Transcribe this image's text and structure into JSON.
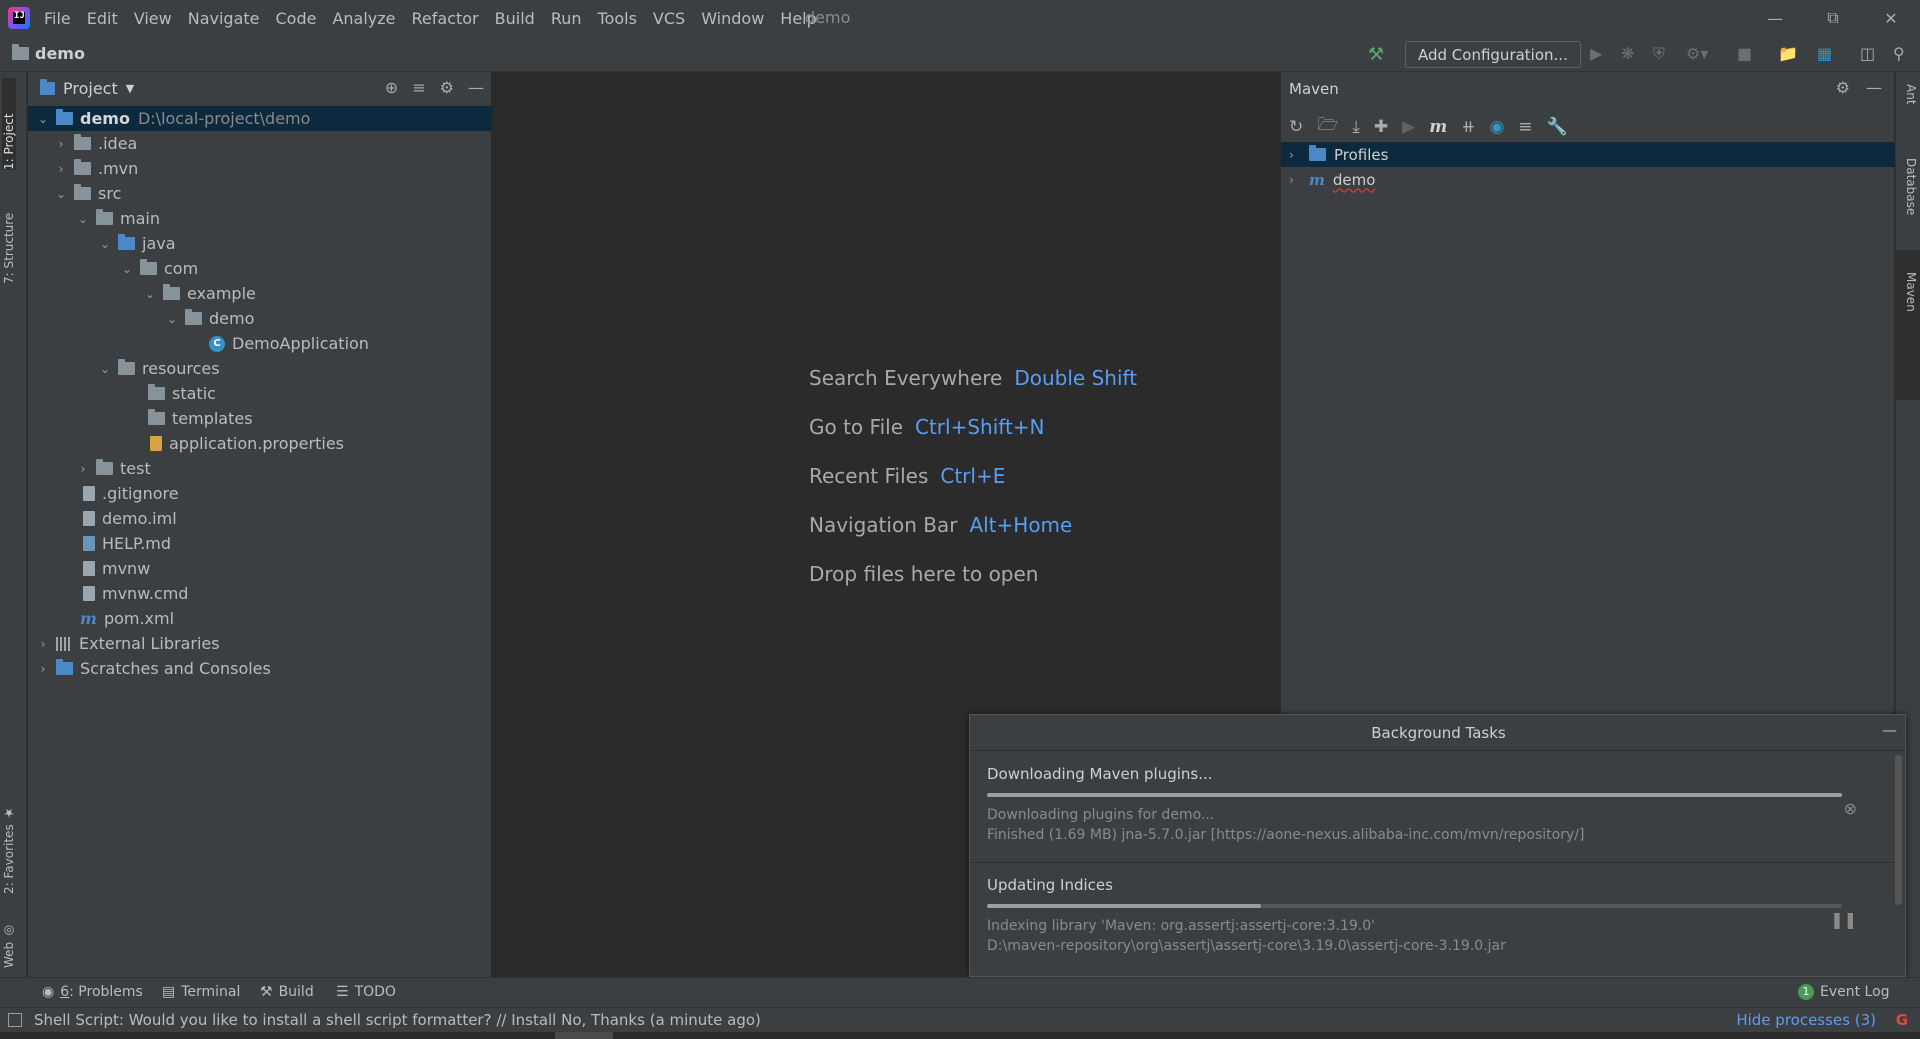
{
  "menu": [
    "File",
    "Edit",
    "View",
    "Navigate",
    "Code",
    "Analyze",
    "Refactor",
    "Build",
    "Run",
    "Tools",
    "VCS",
    "Window",
    "Help"
  ],
  "title_project": "demo",
  "navbar": {
    "breadcrumb": "demo",
    "add_configuration": "Add Configuration..."
  },
  "left_strip": {
    "project_tab": "1: Project",
    "structure_tab": "7: Structure",
    "favorites_tab": "2: Favorites",
    "web_tab": "Web"
  },
  "project_panel": {
    "title": "Project",
    "tree": [
      {
        "label": "demo",
        "path": "D:\\local-project\\demo"
      },
      {
        "label": ".idea"
      },
      {
        "label": ".mvn"
      },
      {
        "label": "src"
      },
      {
        "label": "main"
      },
      {
        "label": "java"
      },
      {
        "label": "com"
      },
      {
        "label": "example"
      },
      {
        "label": "demo"
      },
      {
        "label": "DemoApplication"
      },
      {
        "label": "resources"
      },
      {
        "label": "static"
      },
      {
        "label": "templates"
      },
      {
        "label": "application.properties"
      },
      {
        "label": "test"
      },
      {
        "label": ".gitignore"
      },
      {
        "label": "demo.iml"
      },
      {
        "label": "HELP.md"
      },
      {
        "label": "mvnw"
      },
      {
        "label": "mvnw.cmd"
      },
      {
        "label": "pom.xml"
      },
      {
        "label": "External Libraries"
      },
      {
        "label": "Scratches and Consoles"
      }
    ]
  },
  "editor_hints": [
    {
      "text": "Search Everywhere",
      "key": "Double Shift"
    },
    {
      "text": "Go to File",
      "key": "Ctrl+Shift+N"
    },
    {
      "text": "Recent Files",
      "key": "Ctrl+E"
    },
    {
      "text": "Navigation Bar",
      "key": "Alt+Home"
    },
    {
      "text": "Drop files here to open",
      "key": ""
    }
  ],
  "maven_panel": {
    "title": "Maven",
    "rows": [
      "Profiles",
      "demo"
    ]
  },
  "right_strip": {
    "ant": "Ant",
    "database": "Database",
    "maven": "Maven"
  },
  "background_tasks": {
    "title": "Background Tasks",
    "tasks": [
      {
        "name": "Downloading Maven plugins...",
        "progress": 1.0,
        "line1": "Downloading plugins for demo...",
        "line2": "Finished (1.69 MB) jna-5.7.0.jar [https://aone-nexus.alibaba-inc.com/mvn/repository/]"
      },
      {
        "name": "Updating Indices",
        "progress": 0.32,
        "line1": "Indexing library 'Maven: org.assertj:assertj-core:3.19.0'",
        "line2": "D:\\maven-repository\\org\\assertj\\assertj-core\\3.19.0\\assertj-core-3.19.0.jar"
      }
    ]
  },
  "bottom_tabs": {
    "problems_num": "6",
    "problems_label": ": Problems",
    "terminal": "Terminal",
    "build": "Build",
    "todo": "TODO",
    "event_log": "Event Log",
    "event_log_count": "1"
  },
  "status": {
    "message": "Shell Script: Would you like to install a shell script formatter? // Install   No, Thanks (a minute ago)",
    "hide_processes": "Hide processes (3)"
  }
}
